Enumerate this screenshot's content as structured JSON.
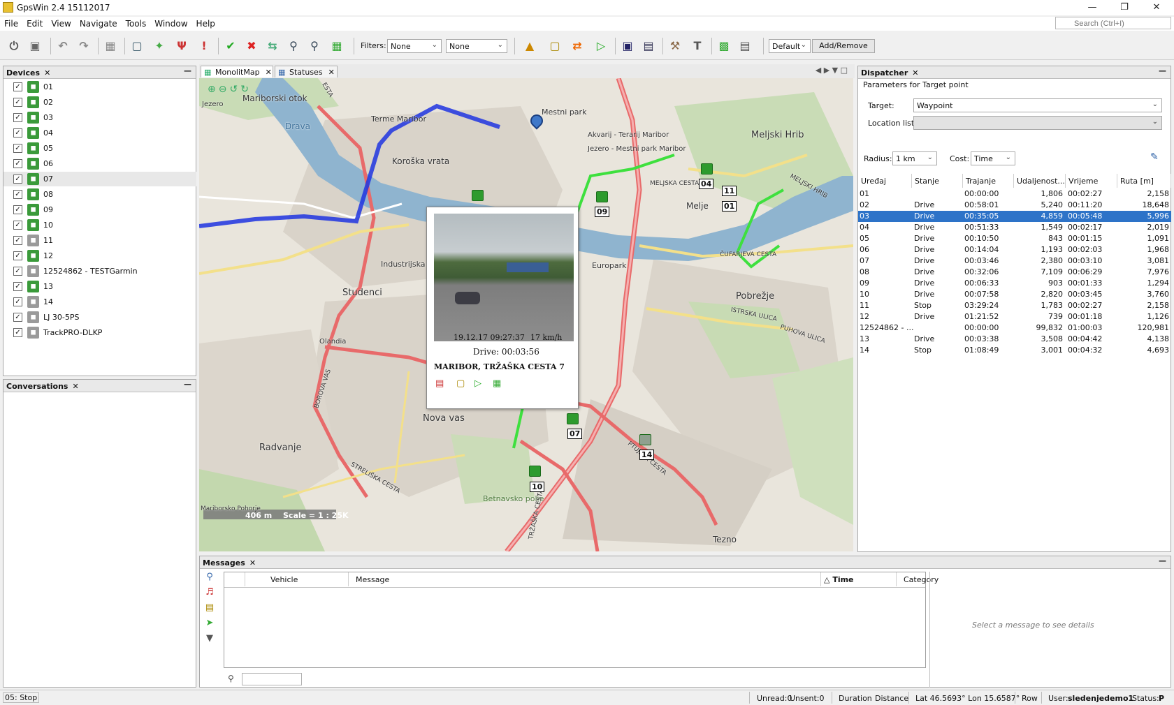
{
  "window": {
    "title": "GpsWin 2.4 15112017",
    "min": "—",
    "restore": "❐",
    "close": "✕"
  },
  "menu": [
    "File",
    "Edit",
    "View",
    "Navigate",
    "Tools",
    "Window",
    "Help"
  ],
  "search": {
    "placeholder": "Search (Ctrl+I)"
  },
  "toolbar": {
    "filters_label": "Filters:",
    "filter1": "None",
    "filter2": "None",
    "layout": "Default",
    "add_remove": "Add/Remove"
  },
  "devices": {
    "title": "Devices",
    "items": [
      {
        "label": "01",
        "active": true
      },
      {
        "label": "02",
        "active": true
      },
      {
        "label": "03",
        "active": true
      },
      {
        "label": "04",
        "active": true
      },
      {
        "label": "05",
        "active": true
      },
      {
        "label": "06",
        "active": true
      },
      {
        "label": "07",
        "active": true
      },
      {
        "label": "08",
        "active": true
      },
      {
        "label": "09",
        "active": true
      },
      {
        "label": "10",
        "active": true
      },
      {
        "label": "11",
        "active": false
      },
      {
        "label": "12",
        "active": true
      },
      {
        "label": "12524862 - TESTGarmin",
        "active": false
      },
      {
        "label": "13",
        "active": true
      },
      {
        "label": "14",
        "active": false
      },
      {
        "label": "LJ 30-5PS",
        "active": false
      },
      {
        "label": "TrackPRO-DLKP",
        "active": false
      }
    ]
  },
  "conversations": {
    "title": "Conversations"
  },
  "tabs": {
    "map": "MonolitMap",
    "statuses": "Statuses"
  },
  "map": {
    "labels": [
      {
        "t": "Mariborski otok"
      },
      {
        "t": "Terme Maribor"
      },
      {
        "t": "Mestni park"
      },
      {
        "t": "Akvarij - Terarij Maribor"
      },
      {
        "t": "Jezero - Mestni park Maribor"
      },
      {
        "t": "Meljski Hrib"
      },
      {
        "t": "Koroška vrata"
      },
      {
        "t": "Drava"
      },
      {
        "t": "Melje"
      },
      {
        "t": "MELJSKA CESTA"
      },
      {
        "t": "MELJSKI HRIB"
      },
      {
        "t": "Europark"
      },
      {
        "t": "ČUFARJEVA CESTA"
      },
      {
        "t": "Pobrežje"
      },
      {
        "t": "ISTRSKA ULICA"
      },
      {
        "t": "PUHOVA ULICA"
      },
      {
        "t": "Industrijska c."
      },
      {
        "t": "Studenci"
      },
      {
        "t": "Olandia"
      },
      {
        "t": "BOROVA VAS"
      },
      {
        "t": "Nova vas"
      },
      {
        "t": "Radvanje"
      },
      {
        "t": "STRELIŠKA CESTA"
      },
      {
        "t": "Betnavsko polje"
      },
      {
        "t": "TRŽAŠKA CESTA"
      },
      {
        "t": "PTUJSKA CESTA"
      },
      {
        "t": "Tezno"
      },
      {
        "t": "Jezero"
      },
      {
        "t": "Mariborsko Pohorje"
      },
      {
        "t": "ESTA"
      }
    ],
    "vehicles": [
      {
        "id": "04"
      },
      {
        "id": "11"
      },
      {
        "id": "01"
      },
      {
        "id": "09"
      },
      {
        "id": "07"
      },
      {
        "id": "10"
      },
      {
        "id": "14"
      }
    ],
    "scale_dist": "406 m",
    "scale_ratio": "Scale = 1 : 25K"
  },
  "popup": {
    "datetime": "19.12.17 09:27:37",
    "speed": "17 km/h",
    "drive": "Drive: 00:03:56",
    "address": "MARIBOR, TRŽAŠKA CESTA 7"
  },
  "dispatcher": {
    "title": "Dispatcher",
    "section": "Parameters for Target point",
    "target_label": "Target:",
    "target_value": "Waypoint",
    "location_label": "Location list:",
    "radius_label": "Radius:",
    "radius_value": "1 km",
    "cost_label": "Cost:",
    "cost_value": "Time",
    "columns": [
      "Uređaj",
      "Stanje",
      "Trajanje",
      "Udaljenost...",
      "Vrijeme",
      "Ruta [m]"
    ],
    "rows": [
      {
        "u": "01",
        "s": "",
        "t": "00:00:00",
        "d": "1,806",
        "v": "00:02:27",
        "r": "2,158"
      },
      {
        "u": "02",
        "s": "Drive",
        "t": "00:58:01",
        "d": "5,240",
        "v": "00:11:20",
        "r": "18,648"
      },
      {
        "u": "03",
        "s": "Drive",
        "t": "00:35:05",
        "d": "4,859",
        "v": "00:05:48",
        "r": "5,996",
        "sel": true
      },
      {
        "u": "04",
        "s": "Drive",
        "t": "00:51:33",
        "d": "1,549",
        "v": "00:02:17",
        "r": "2,019"
      },
      {
        "u": "05",
        "s": "Drive",
        "t": "00:10:50",
        "d": "843",
        "v": "00:01:15",
        "r": "1,091"
      },
      {
        "u": "06",
        "s": "Drive",
        "t": "00:14:04",
        "d": "1,193",
        "v": "00:02:03",
        "r": "1,968"
      },
      {
        "u": "07",
        "s": "Drive",
        "t": "00:03:46",
        "d": "2,380",
        "v": "00:03:10",
        "r": "3,081"
      },
      {
        "u": "08",
        "s": "Drive",
        "t": "00:32:06",
        "d": "7,109",
        "v": "00:06:29",
        "r": "7,976"
      },
      {
        "u": "09",
        "s": "Drive",
        "t": "00:06:33",
        "d": "903",
        "v": "00:01:33",
        "r": "1,294"
      },
      {
        "u": "10",
        "s": "Drive",
        "t": "00:07:58",
        "d": "2,820",
        "v": "00:03:45",
        "r": "3,760"
      },
      {
        "u": "11",
        "s": "Stop",
        "t": "03:29:24",
        "d": "1,783",
        "v": "00:02:27",
        "r": "2,158"
      },
      {
        "u": "12",
        "s": "Drive",
        "t": "01:21:52",
        "d": "739",
        "v": "00:01:18",
        "r": "1,126"
      },
      {
        "u": "12524862 - ...",
        "s": "",
        "t": "00:00:00",
        "d": "99,832",
        "v": "01:00:03",
        "r": "120,981"
      },
      {
        "u": "13",
        "s": "Drive",
        "t": "00:03:38",
        "d": "3,508",
        "v": "00:04:42",
        "r": "4,138"
      },
      {
        "u": "14",
        "s": "Stop",
        "t": "01:08:49",
        "d": "3,001",
        "v": "00:04:32",
        "r": "4,693"
      }
    ]
  },
  "messages": {
    "title": "Messages",
    "columns": [
      "Vehicle",
      "Message",
      "Time",
      "Category"
    ],
    "sort_arrow": "△",
    "detail_hint": "Select a message to see details"
  },
  "status": {
    "left": "05: Stop",
    "unread": "Unread:0",
    "unsent": "Unsent:0",
    "duration": "Duration",
    "distance": "Distance",
    "coords": "Lat 46.5693° Lon 15.6587°",
    "row": "Row",
    "user_label": "User:",
    "user": "sledenjedemo1",
    "status_label": "Status:",
    "status_value": "P"
  },
  "colors": {
    "route_blue": "#1f34e0",
    "track_green": "#3ee03e",
    "road_red": "#e05050",
    "selection": "#2d73c8"
  }
}
